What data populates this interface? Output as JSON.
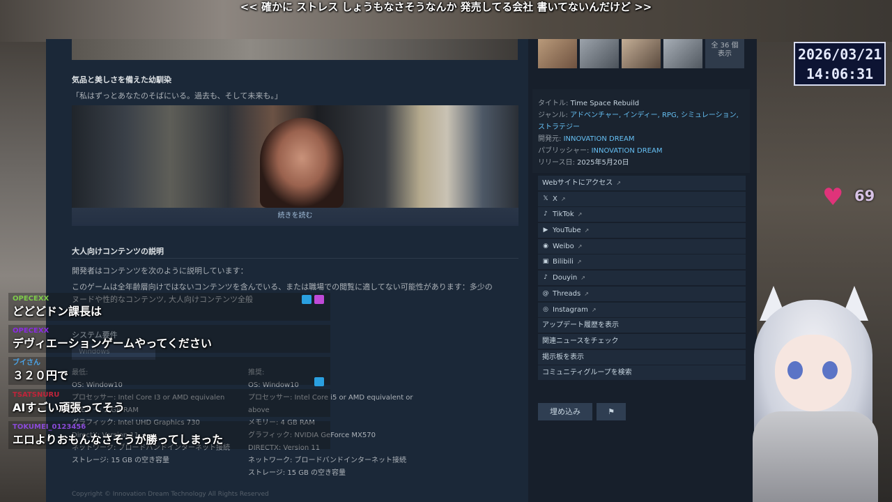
{
  "overlay": {
    "subtitle": "<< 確かに ストレス しょうもなさそうなんか 発売してる会社 書いてないんだけど >>",
    "clock_date": "2026/03/21",
    "clock_time": "14:06:31",
    "heart_count": "69"
  },
  "main": {
    "section1_title": "気品と美しさを備えた幼馴染",
    "section1_quote": "「私はずっとあなたのそばにいる。過去も、そして未来も。」",
    "read_more": "続きを読む",
    "adult_title": "大人向けコンテンツの説明",
    "adult_line1": "開発者はコンテンツを次のように説明しています：",
    "adult_line2": "このゲームは全年齢層向けではないコンテンツを含んでいる、または職場での閲覧に適してない可能性があります：多少の",
    "adult_line3": "ヌードや性的なコンテンツ, 大人向けコンテンツ全般",
    "sysreq_title": "システム要件",
    "sysreq_tab": "Windows",
    "min": {
      "header": "最低:",
      "os": "OS:  Window10",
      "cpu": "プロセッサー:  Intel Core I3 or AMD equivalen",
      "mem": "メモリー:  2 GB RAM",
      "gpu": "グラフィック:  Intel UHD Graphics 730",
      "dx": "DirectX:  Version 11",
      "net": "ネットワーク:  ブロードバンドインターネット接続",
      "storage": "ストレージ:  15 GB の空き容量"
    },
    "rec": {
      "header": "推奨:",
      "os": "OS:  Window10",
      "cpu": "プロセッサー:  Intel Core i5 or AMD equivalent or",
      "cpu2": "above",
      "mem": "メモリー:  4 GB RAM",
      "gpu": "グラフィック:  NVIDIA GeForce MX570",
      "dx": "DIRECTX:  Version 11",
      "net": "ネットワーク:  ブロードバンドインターネット接続",
      "storage": "ストレージ:  15 GB の空き容量"
    },
    "copyright": "Copyright © Innovation Dream Technology All Rights Reserved"
  },
  "sidebar": {
    "show_all_line1": "全 36 個",
    "show_all_line2": "表示",
    "title_label": "タイトル:",
    "title_value": "Time Space Rebuild",
    "genre_label": "ジャンル:",
    "genre_value": "アドベンチャー, インディー, RPG, シミュレーション, ストラテジー",
    "developer_label": "開発元:",
    "developer_value": "INNOVATION DREAM",
    "publisher_label": "パブリッシャー:",
    "publisher_value": "INNOVATION DREAM",
    "release_label": "リリース日:",
    "release_value": "2025年5月20日",
    "links": [
      {
        "label": "Webサイトにアクセス",
        "icon": "",
        "ext": true
      },
      {
        "label": "X",
        "icon": "x-icon",
        "ext": true
      },
      {
        "label": "TikTok",
        "icon": "tiktok-icon",
        "ext": true
      },
      {
        "label": "YouTube",
        "icon": "youtube-icon",
        "ext": true
      },
      {
        "label": "Weibo",
        "icon": "weibo-icon",
        "ext": true
      },
      {
        "label": "Bilibili",
        "icon": "bilibili-icon",
        "ext": true
      },
      {
        "label": "Douyin",
        "icon": "douyin-icon",
        "ext": true
      },
      {
        "label": "Threads",
        "icon": "threads-icon",
        "ext": true
      },
      {
        "label": "Instagram",
        "icon": "instagram-icon",
        "ext": true
      },
      {
        "label": "アップデート履歴を表示",
        "icon": "",
        "ext": false
      },
      {
        "label": "関連ニュースをチェック",
        "icon": "",
        "ext": false
      },
      {
        "label": "掲示板を表示",
        "icon": "",
        "ext": false
      },
      {
        "label": "コミュニティグループを検索",
        "icon": "",
        "ext": false
      }
    ],
    "embed_label": "埋め込み"
  },
  "chat": [
    {
      "name": "OPECEXX",
      "text": "どどどドン課長は",
      "color": "#7ecb4a"
    },
    {
      "name": "OPECEXX",
      "text": "デヴィエーションゲームやってください",
      "color": "#8a2be2"
    },
    {
      "name": "ブイさん",
      "text": "３２０円で",
      "color": "#4aa3e8"
    },
    {
      "name": "TSATSNURU",
      "text": "AIすごい頑張ってそう",
      "color": "#c0243a"
    },
    {
      "name": "TOKUMEI_0123456",
      "text": "エロよりおもんなさそうが勝ってしまった",
      "color": "#8a4ad8"
    }
  ]
}
